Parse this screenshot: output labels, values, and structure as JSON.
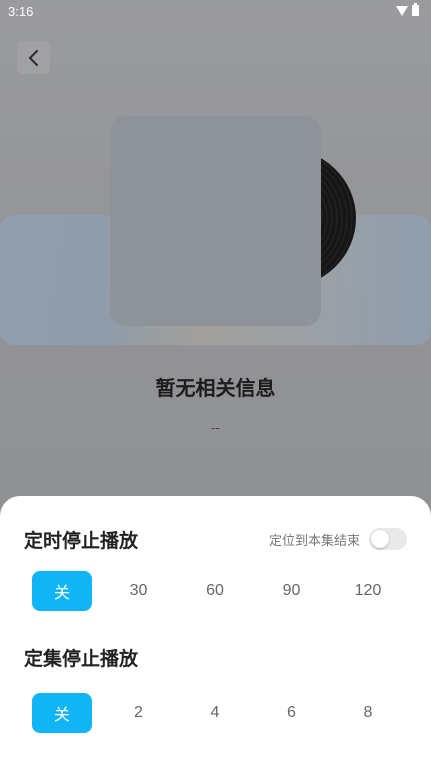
{
  "status_bar": {
    "time": "3:16",
    "icons": [
      "wifi-icon",
      "battery-icon"
    ]
  },
  "header": {
    "back_icon": "chevron-left-icon"
  },
  "player": {
    "title": "暂无相关信息",
    "subtitle": "--",
    "colors": {
      "overlay": "#8f9195",
      "cover": "#8e9399",
      "record": "#161616"
    }
  },
  "sleep_timer": {
    "minutes_section_title": "定时停止播放",
    "locate_label": "定位到本集结束",
    "locate_enabled": false,
    "minute_options": [
      "关",
      "30",
      "60",
      "90",
      "120"
    ],
    "minute_selected": "关",
    "episodes_section_title": "定集停止播放",
    "episode_options": [
      "关",
      "2",
      "4",
      "6",
      "8"
    ],
    "episode_selected": "关",
    "accent_color": "#11b5f5"
  }
}
